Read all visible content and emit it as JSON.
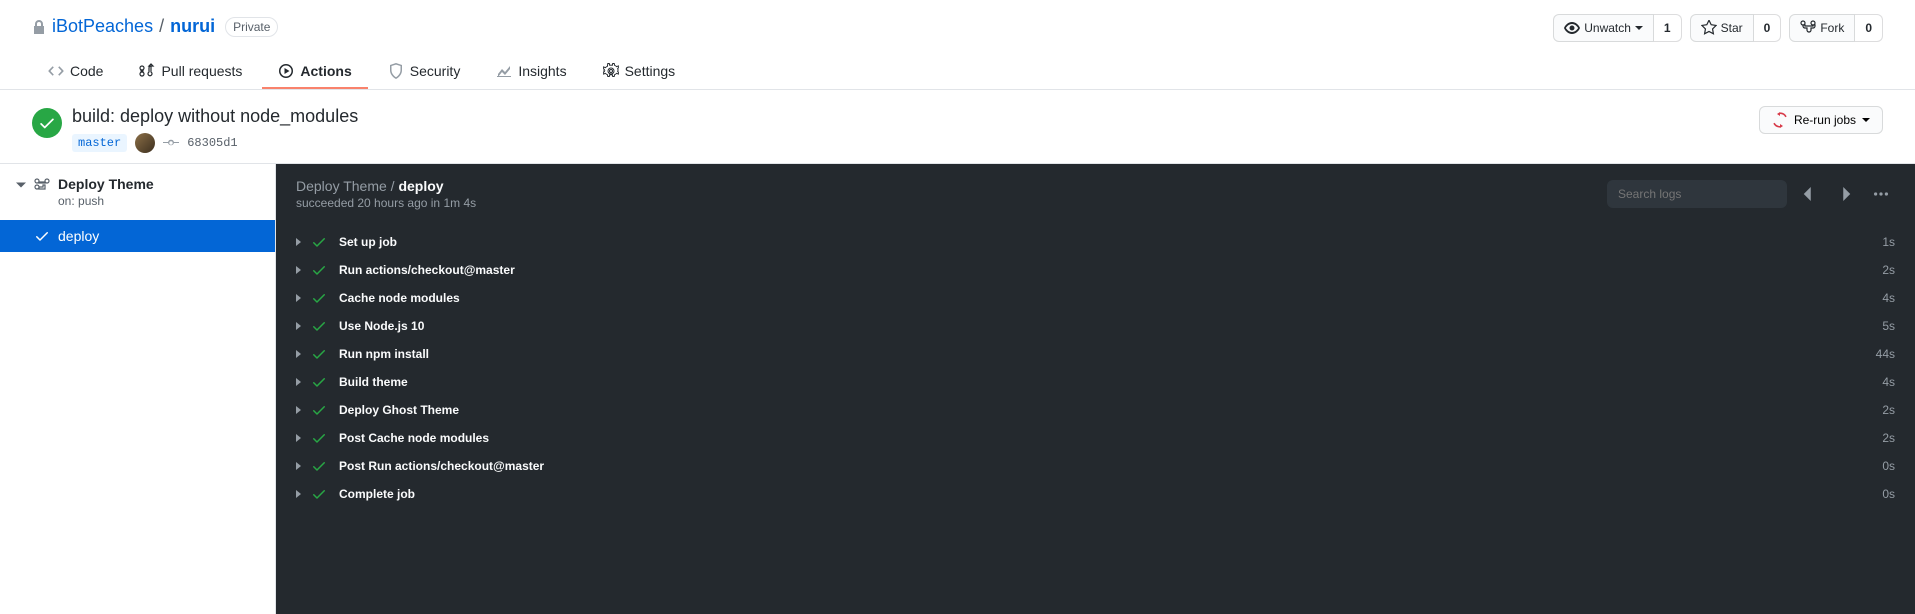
{
  "repo": {
    "owner": "iBotPeaches",
    "name": "nurui",
    "visibility": "Private"
  },
  "pagehead_actions": {
    "watch": {
      "label": "Unwatch",
      "count": "1"
    },
    "star": {
      "label": "Star",
      "count": "0"
    },
    "fork": {
      "label": "Fork",
      "count": "0"
    }
  },
  "nav": {
    "code": "Code",
    "pulls": "Pull requests",
    "actions": "Actions",
    "security": "Security",
    "insights": "Insights",
    "settings": "Settings"
  },
  "run": {
    "title": "build: deploy without node_modules",
    "branch": "master",
    "sha": "68305d1",
    "rerun_label": "Re-run jobs"
  },
  "sidebar": {
    "workflow_name": "Deploy Theme",
    "trigger": "on: push",
    "job_name": "deploy"
  },
  "log": {
    "breadcrumb_workflow": "Deploy Theme",
    "breadcrumb_job": "deploy",
    "status_line": "succeeded 20 hours ago in 1m 4s",
    "search_placeholder": "Search logs"
  },
  "steps": [
    {
      "name": "Set up job",
      "duration": "1s"
    },
    {
      "name": "Run actions/checkout@master",
      "duration": "2s"
    },
    {
      "name": "Cache node modules",
      "duration": "4s"
    },
    {
      "name": "Use Node.js 10",
      "duration": "5s"
    },
    {
      "name": "Run npm install",
      "duration": "44s"
    },
    {
      "name": "Build theme",
      "duration": "4s"
    },
    {
      "name": "Deploy Ghost Theme",
      "duration": "2s"
    },
    {
      "name": "Post Cache node modules",
      "duration": "2s"
    },
    {
      "name": "Post Run actions/checkout@master",
      "duration": "0s"
    },
    {
      "name": "Complete job",
      "duration": "0s"
    }
  ]
}
